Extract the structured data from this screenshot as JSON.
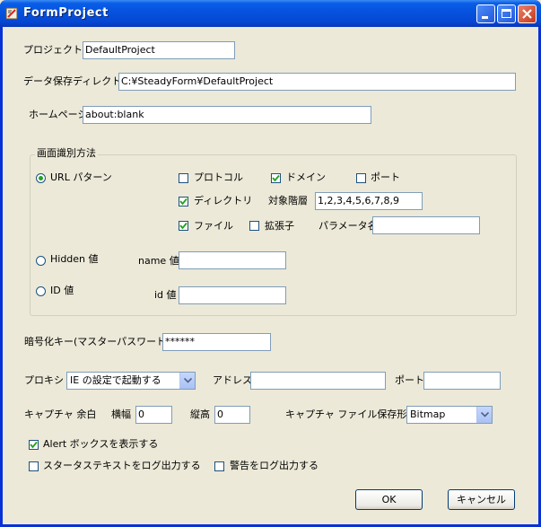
{
  "window": {
    "title": "FormProject"
  },
  "project": {
    "name_label": "プロジェクト名",
    "name_value": "DefaultProject"
  },
  "data_dir": {
    "label": "データ保存ディレクトリ",
    "value": "C:¥SteadyForm¥DefaultProject"
  },
  "homepage": {
    "label": "ホームページ",
    "value": "about:blank"
  },
  "identify": {
    "group_title": "画面識別方法",
    "url_pattern_label": "URL パターン",
    "url_pattern_selected": true,
    "protocol_label": "プロトコル",
    "protocol_checked": false,
    "domain_label": "ドメイン",
    "domain_checked": true,
    "port_label": "ポート",
    "port_checked": false,
    "directory_label": "ディレクトリ",
    "directory_checked": true,
    "target_level_label": "対象階層",
    "target_level_value": "1,2,3,4,5,6,7,8,9",
    "file_label": "ファイル",
    "file_checked": true,
    "extension_label": "拡張子",
    "extension_checked": false,
    "param_name_label": "パラメータ名",
    "param_name_value": "",
    "hidden_label": "Hidden 値",
    "hidden_selected": false,
    "name_value_label": "name 値",
    "name_value": "",
    "id_label": "ID 値",
    "id_selected": false,
    "id_value_label": "id 値",
    "id_value": ""
  },
  "encryption": {
    "label": "暗号化キー(マスターパスワード)",
    "value": "******"
  },
  "proxy": {
    "label": "プロキシ",
    "selected": "IE の設定で起動する",
    "address_label": "アドレス",
    "address_value": "",
    "port_label": "ポート",
    "port_value": ""
  },
  "capture": {
    "margin_label": "キャプチャ 余白",
    "width_label": "横幅",
    "width_value": "0",
    "height_label": "縦高",
    "height_value": "0",
    "format_label": "キャプチャ ファイル保存形式",
    "format_selected": "Bitmap"
  },
  "options": {
    "alert_label": "Alert ボックスを表示する",
    "alert_checked": true,
    "status_log_label": "スタータステキストをログ出力する",
    "status_log_checked": false,
    "warning_log_label": "警告をログ出力する",
    "warning_log_checked": false
  },
  "buttons": {
    "ok": "OK",
    "cancel": "キャンセル"
  },
  "colors": {
    "titlebar": "#0a5ee8",
    "window_bg": "#ece9d8",
    "check": "#21a121"
  }
}
